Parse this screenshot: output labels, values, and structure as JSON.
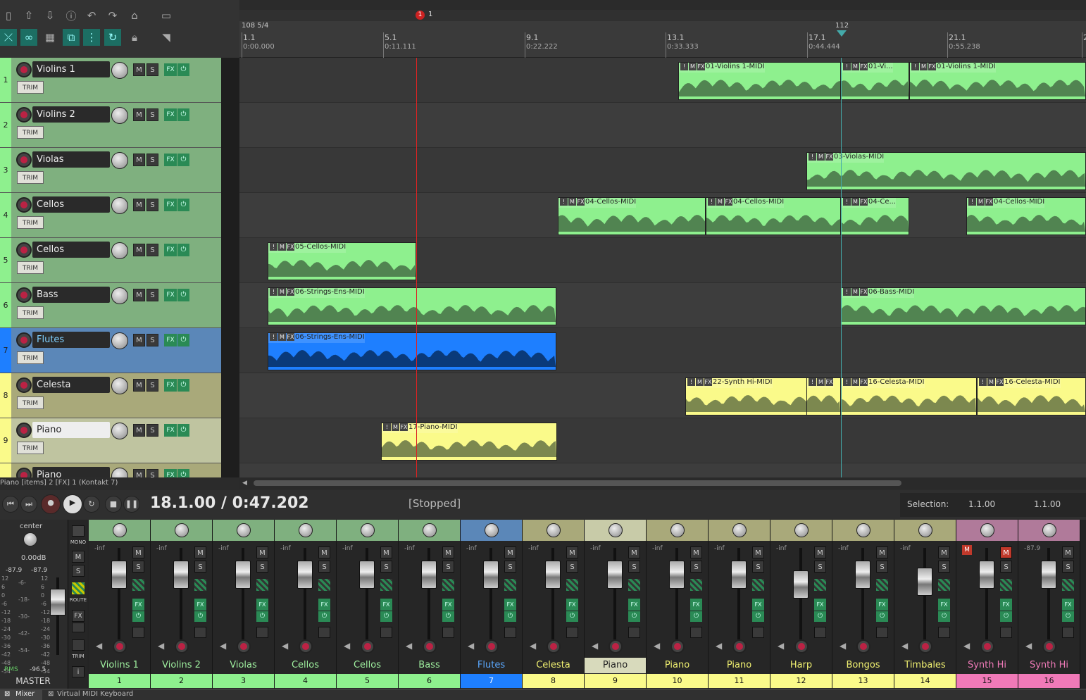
{
  "status_line": "Piano [items] 2 [FX] 1 (Kontakt 7)",
  "ruler": {
    "marker_num": "1",
    "marker_label": "1",
    "tempo": "108 5/4",
    "tempo_end": "112",
    "bars": [
      {
        "label": "1.1",
        "time": "0:00.000"
      },
      {
        "label": "5.1",
        "time": "0:11.111"
      },
      {
        "label": "9.1",
        "time": "0:22.222"
      },
      {
        "label": "13.1",
        "time": "0:33.333"
      },
      {
        "label": "17.1",
        "time": "0:44.444"
      },
      {
        "label": "21.1",
        "time": "0:55.238"
      },
      {
        "label": "2",
        "time": ""
      }
    ]
  },
  "tracks": [
    {
      "num": "1",
      "name": "Violins 1",
      "color": "#7fb07f",
      "trim": "TRIM"
    },
    {
      "num": "2",
      "name": "Violins 2",
      "color": "#7fb07f",
      "trim": "TRIM"
    },
    {
      "num": "3",
      "name": "Violas",
      "color": "#7fb07f",
      "trim": "TRIM"
    },
    {
      "num": "4",
      "name": "Cellos",
      "color": "#7fb07f",
      "trim": "TRIM"
    },
    {
      "num": "5",
      "name": "Cellos",
      "color": "#7fb07f",
      "trim": "TRIM"
    },
    {
      "num": "6",
      "name": "Bass",
      "color": "#7fb07f",
      "trim": "TRIM"
    },
    {
      "num": "7",
      "name": "Flutes",
      "color": "#5b87b8",
      "trim": "TRIM"
    },
    {
      "num": "8",
      "name": "Celesta",
      "color": "#a9a97a",
      "trim": "TRIM"
    },
    {
      "num": "9",
      "name": "Piano",
      "color": "#bfc4a0",
      "trim": "TRIM"
    },
    {
      "num": "10",
      "name": "Piano",
      "color": "#a9a97a",
      "trim": "TRIM"
    }
  ],
  "items": [
    {
      "lane": 0,
      "start": 623,
      "end": 854,
      "label": "01-Violins 1-MIDI",
      "color": "#8ef08e"
    },
    {
      "lane": 0,
      "start": 854,
      "end": 951,
      "label": "01-Vi...",
      "color": "#8ef08e"
    },
    {
      "lane": 0,
      "start": 951,
      "end": 1202,
      "label": "01-Violins 1-MIDI",
      "color": "#8ef08e"
    },
    {
      "lane": 2,
      "start": 805,
      "end": 1202,
      "label": "03-Violas-MIDI",
      "color": "#8ef08e"
    },
    {
      "lane": 3,
      "start": 452,
      "end": 662,
      "label": "04-Cellos-MIDI",
      "color": "#8ef08e"
    },
    {
      "lane": 3,
      "start": 662,
      "end": 854,
      "label": "04-Cellos-MIDI",
      "color": "#8ef08e"
    },
    {
      "lane": 3,
      "start": 854,
      "end": 951,
      "label": "04-Ce...",
      "color": "#8ef08e"
    },
    {
      "lane": 3,
      "start": 1032,
      "end": 1202,
      "label": "04-Cellos-MIDI",
      "color": "#8ef08e"
    },
    {
      "lane": 4,
      "start": 40,
      "end": 251,
      "label": "05-Cellos-MIDI",
      "color": "#8ef08e"
    },
    {
      "lane": 5,
      "start": 40,
      "end": 450,
      "label": "06-Strings-Ens-MIDI",
      "color": "#8ef08e"
    },
    {
      "lane": 5,
      "start": 854,
      "end": 1202,
      "label": "06-Bass-MIDI",
      "color": "#8ef08e"
    },
    {
      "lane": 6,
      "start": 40,
      "end": 450,
      "label": "06-Strings-Ens-MIDI",
      "color": "#1e7fff"
    },
    {
      "lane": 7,
      "start": 633,
      "end": 854,
      "label": "22-Synth Hi-MIDI",
      "color": "#fafa8a"
    },
    {
      "lane": 7,
      "start": 805,
      "end": 854,
      "label": "",
      "color": "#fafa8a"
    },
    {
      "lane": 7,
      "start": 854,
      "end": 1047,
      "label": "16-Celesta-MIDI",
      "color": "#fafa8a"
    },
    {
      "lane": 7,
      "start": 1047,
      "end": 1202,
      "label": "16-Celesta-MIDI",
      "color": "#fafa8a"
    },
    {
      "lane": 8,
      "start": 201,
      "end": 451,
      "label": "17-Piano-MIDI",
      "color": "#fafa8a"
    }
  ],
  "transport": {
    "time": "18.1.00 / 0:47.202",
    "state": "[Stopped]",
    "selection_label": "Selection:",
    "sel_start": "1.1.00",
    "sel_end": "1.1.00"
  },
  "master": {
    "pan": "center",
    "db": "0.00dB",
    "peak_l": "-87.9",
    "peak_r": "-87.9",
    "rms_label": "RMS",
    "rms_value": "-96.5",
    "name": "MASTER",
    "mono": "MONO",
    "route": "ROUTE",
    "fx": "FX",
    "trim": "TRIM",
    "scale": [
      "12",
      "6",
      "0",
      "-6",
      "-12",
      "-18",
      "-24",
      "-30",
      "-36",
      "-42",
      "-48",
      "-54"
    ],
    "scale_mid": [
      "-6-",
      "-18-",
      "-30-",
      "-42-",
      "-54-"
    ]
  },
  "strips": [
    {
      "name": "Violins 1",
      "num": "1",
      "color": "#7fb07f",
      "numcolor": "#8ef08e",
      "inf": "-inf",
      "mute": false
    },
    {
      "name": "Violins 2",
      "num": "2",
      "color": "#7fb07f",
      "numcolor": "#8ef08e",
      "inf": "-inf",
      "mute": false
    },
    {
      "name": "Violas",
      "num": "3",
      "color": "#7fb07f",
      "numcolor": "#8ef08e",
      "inf": "-inf",
      "mute": false
    },
    {
      "name": "Cellos",
      "num": "4",
      "color": "#7fb07f",
      "numcolor": "#8ef08e",
      "inf": "-inf",
      "mute": false
    },
    {
      "name": "Cellos",
      "num": "5",
      "color": "#7fb07f",
      "numcolor": "#8ef08e",
      "inf": "-inf",
      "mute": false
    },
    {
      "name": "Bass",
      "num": "6",
      "color": "#7fb07f",
      "numcolor": "#8ef08e",
      "inf": "-inf",
      "mute": false
    },
    {
      "name": "Flutes",
      "num": "7",
      "color": "#5b87b8",
      "numcolor": "#1e7fff",
      "inf": "-inf",
      "mute": false
    },
    {
      "name": "Celesta",
      "num": "8",
      "color": "#a9a97a",
      "numcolor": "#fafa8a",
      "inf": "-inf",
      "mute": false
    },
    {
      "name": "Piano",
      "num": "9",
      "color": "#c8cba8",
      "numcolor": "#fafa8a",
      "inf": "-inf",
      "mute": false
    },
    {
      "name": "Piano",
      "num": "10",
      "color": "#a9a97a",
      "numcolor": "#fafa8a",
      "inf": "-inf",
      "mute": false
    },
    {
      "name": "Piano",
      "num": "11",
      "color": "#a9a97a",
      "numcolor": "#fafa8a",
      "inf": "-inf",
      "mute": false
    },
    {
      "name": "Harp",
      "num": "12",
      "color": "#a9a97a",
      "numcolor": "#fafa8a",
      "inf": "-inf",
      "mute": false
    },
    {
      "name": "Bongos",
      "num": "13",
      "color": "#a9a97a",
      "numcolor": "#fafa8a",
      "inf": "-inf",
      "mute": false
    },
    {
      "name": "Timbales",
      "num": "14",
      "color": "#a9a97a",
      "numcolor": "#fafa8a",
      "inf": "-inf",
      "mute": false
    },
    {
      "name": "Synth Hi",
      "num": "15",
      "color": "#b07a9a",
      "numcolor": "#f07ab8",
      "inf": "",
      "mute": true
    },
    {
      "name": "Synth Hi",
      "num": "16",
      "color": "#b07a9a",
      "numcolor": "#f07ab8",
      "inf": "-87.9",
      "mute": false
    }
  ],
  "labels": {
    "m": "M",
    "s": "S",
    "fx": "FX"
  },
  "bottom": {
    "mixer_tab": "Mixer",
    "vmk_tab": "Virtual MIDI Keyboard"
  }
}
